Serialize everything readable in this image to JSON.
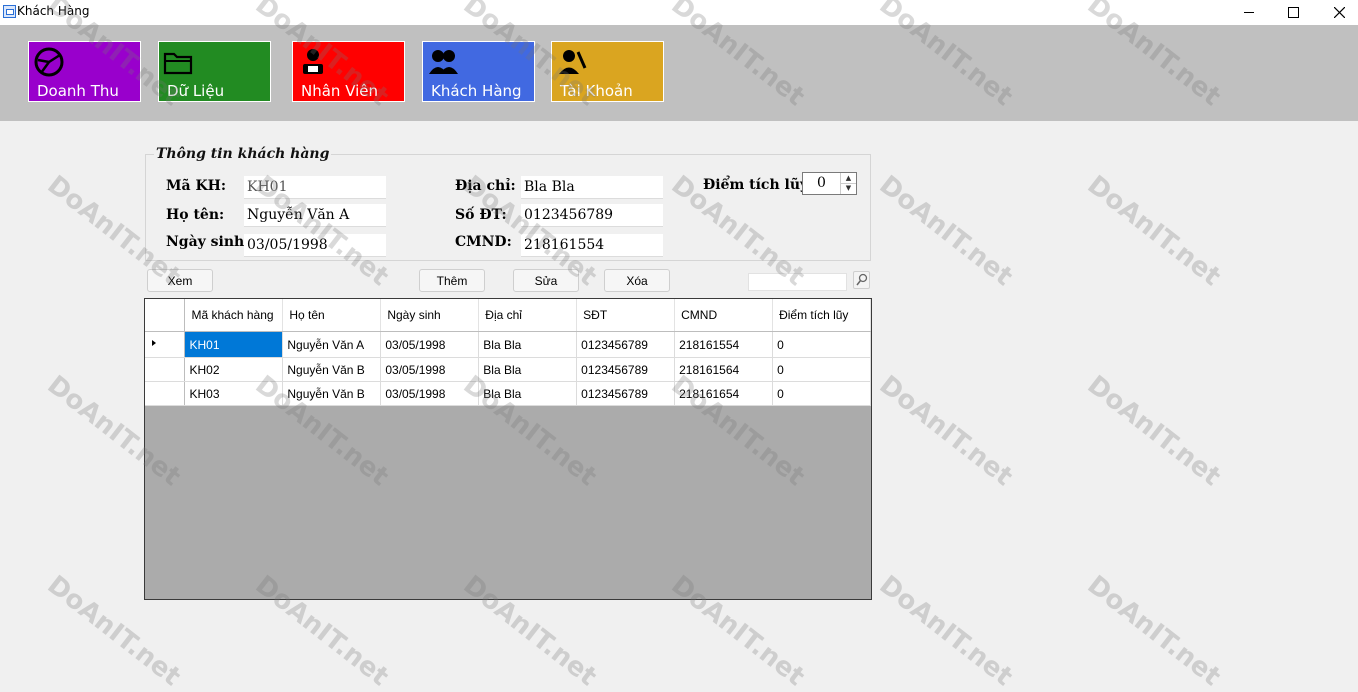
{
  "window": {
    "title": "Khách Hàng"
  },
  "nav": [
    {
      "label": "Doanh Thu",
      "color": "#9900cc",
      "icon": "chart-pie-icon"
    },
    {
      "label": "Dữ Liệu",
      "color": "#228b22",
      "icon": "folder-icon"
    },
    {
      "label": "Nhân Viên",
      "color": "#ff0000",
      "icon": "employee-icon"
    },
    {
      "label": "Khách Hàng",
      "color": "#4169e1",
      "icon": "customers-icon"
    },
    {
      "label": "Tài Khoản",
      "color": "#daa520",
      "icon": "account-icon"
    }
  ],
  "form": {
    "group_title": "Thông tin khách hàng",
    "ma_kh": {
      "label": "Mã KH:",
      "value": "KH01"
    },
    "ho_ten": {
      "label": "Họ tên:",
      "value": "Nguyễn Văn A"
    },
    "ngay_sinh": {
      "label": "Ngày sinh:",
      "value": "03/05/1998"
    },
    "dia_chi": {
      "label": "Địa chỉ:",
      "value": "Bla Bla"
    },
    "so_dt": {
      "label": "Số ĐT:",
      "value": "0123456789"
    },
    "cmnd": {
      "label": "CMND:",
      "value": "218161554"
    },
    "diem": {
      "label": "Điểm tích lũy:",
      "value": "0"
    }
  },
  "actions": {
    "view": "Xem",
    "add": "Thêm",
    "edit": "Sửa",
    "delete": "Xóa"
  },
  "search": {
    "value": ""
  },
  "table": {
    "columns": [
      "Mã khách hàng",
      "Họ tên",
      "Ngày sinh",
      "Địa chỉ",
      "SĐT",
      "CMND",
      "Điểm tích lũy"
    ],
    "rows": [
      [
        "KH01",
        "Nguyễn Văn A",
        "03/05/1998",
        "Bla Bla",
        "0123456789",
        "218161554",
        "0"
      ],
      [
        "KH02",
        "Nguyễn Văn B",
        "03/05/1998",
        "Bla Bla",
        "0123456789",
        "218161564",
        "0"
      ],
      [
        "KH03",
        "Nguyễn Văn B",
        "03/05/1998",
        "Bla Bla",
        "0123456789",
        "218161654",
        "0"
      ]
    ],
    "selected_row": 0
  },
  "watermark": "DoAnIT.net"
}
